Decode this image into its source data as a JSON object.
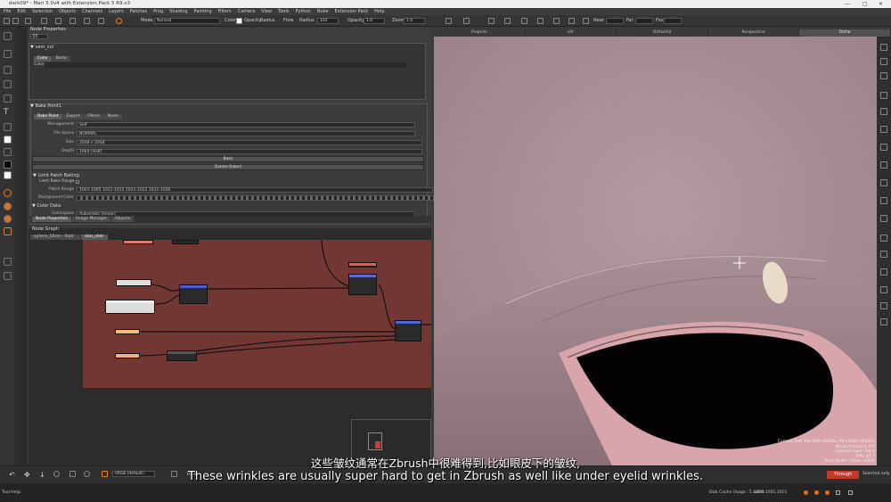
{
  "window": {
    "title": "dark09* - Mari 5.0v4 with Extension Pack 5 R9.v3"
  },
  "menu": [
    "File",
    "Edit",
    "Selection",
    "Objects",
    "Channels",
    "Layers",
    "Patches",
    "Prog",
    "Shading",
    "Painting",
    "Filters",
    "Camera",
    "View",
    "Tools",
    "Python",
    "Nuke",
    "Extension Pack",
    "Help"
  ],
  "toolbar": {
    "mode_label": "Mode",
    "mode_value": "Normal",
    "color_label": "Color",
    "opacity_label": "Opacity",
    "radius_label": "Radius",
    "flow_label": "Flow",
    "radius2_label": "Radius",
    "radius2_value": "102",
    "opacity2_label": "Opacity",
    "opacity2_value": "1.0",
    "zoom_label": "Zoom",
    "zoom_value": "1.0",
    "near_label": "Near",
    "far_label": "Far",
    "fov_label": "Fov"
  },
  "node_properties": {
    "header": "Node Properties",
    "count": "33",
    "node1": {
      "name": "vam_col",
      "tabs": [
        "Color",
        "Node"
      ],
      "color_label": "Color"
    },
    "bake": {
      "name": "Bake Point1",
      "tabs": [
        "Bake Point",
        "Export",
        "Filters",
        "Node"
      ],
      "rows": [
        {
          "k": "Management",
          "v": "Self"
        },
        {
          "k": "File Space",
          "v": "NORMAL"
        },
        {
          "k": "Size",
          "v": "2048 x 2048"
        },
        {
          "k": "Depth",
          "v": "16bit (Half)"
        }
      ],
      "bake_button": "Bake",
      "delete_button": "Delete Baked",
      "limit_section": "Limit Patch Baking",
      "limit_range_label": "Limit Bake Range",
      "patch_range_label": "Patch Range",
      "patch_range_value": "1001-1005 1011-1015 1021-1022 1031-1036",
      "bg_color_label": "Background Color"
    },
    "color_data": {
      "section": "Color Data",
      "colorspace_label": "Colorspace",
      "colorspace_value": "Automatic (linear)"
    }
  },
  "lower_tabs": [
    "Node Properties",
    "Image Manager",
    "Objects"
  ],
  "node_graph": {
    "title": "Node Graph",
    "tabs": [
      "sphere_50cm - Root",
      "skin_shdr"
    ]
  },
  "viewport_tabs": [
    "Projects",
    "UV",
    "Ortho/UV",
    "Perspective",
    "Ortho"
  ],
  "viewport_tab_active": "Ortho",
  "tool_info": [
    "Current Tool: Pan (Alt+Middle, Alt+Shift+Middle)",
    "Brush Pressure: 0.0",
    "Current Layer: Paint",
    "FPS: 47.7",
    "Paint Buffer: Clear: 100%"
  ],
  "bottom": {
    "colorspace": "sRGB (default)",
    "channel": "RGB",
    "through_button": "Through",
    "selected_status": "Selected only",
    "disk_cache": "Disk Cache Usage : 5.42GB",
    "udim": "udim:1001,1011",
    "tool_help": "Tool Help:"
  },
  "subtitles": {
    "cn": "这些皱纹通常在Zbrush中很难得到,比如眼皮下的皱纹,",
    "en": "These wrinkles are usually super hard to get in Zbrush as well like under eyelid wrinkles."
  },
  "colors": {
    "graph_bg": "#733733",
    "viewport_skin": "#a58d92",
    "through": "#c0392b"
  }
}
